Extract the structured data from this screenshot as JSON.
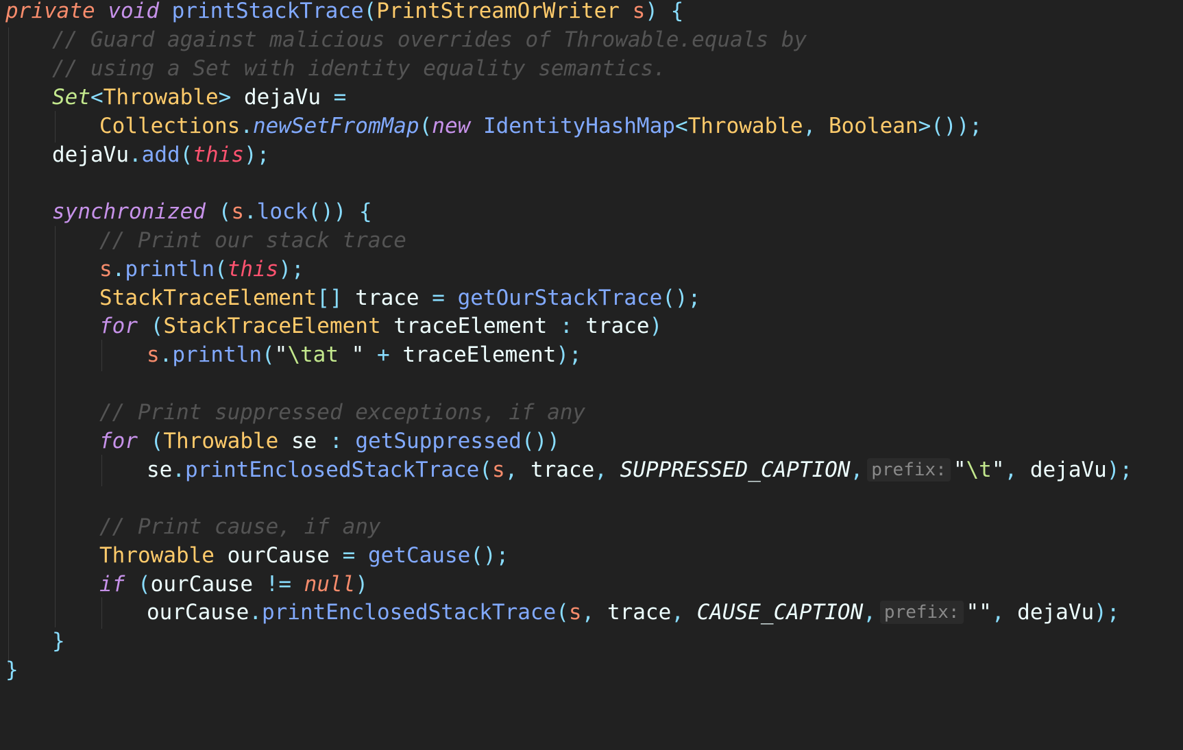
{
  "editor": {
    "background": "#212121",
    "lines": [
      "private void printStackTrace(PrintStreamOrWriter s) {",
      "// Guard against malicious overrides of Throwable.equals by",
      "// using a Set with identity equality semantics.",
      "Set<Throwable> dejaVu =",
      "Collections.newSetFromMap(new IdentityHashMap<Throwable, Boolean>());",
      "dejaVu.add(this);",
      "",
      "synchronized (s.lock()) {",
      "// Print our stack trace",
      "s.println(this);",
      "StackTraceElement[] trace = getOurStackTrace();",
      "for (StackTraceElement traceElement : trace)",
      "s.println(\"\\tat \" + traceElement);",
      "",
      "// Print suppressed exceptions, if any",
      "for (Throwable se : getSuppressed())",
      "se.printEnclosedStackTrace(s, trace, SUPPRESSED_CAPTION, prefix: \"\\t\", dejaVu);",
      "",
      "// Print cause, if any",
      "Throwable ourCause = getCause();",
      "if (ourCause != null)",
      "ourCause.printEnclosedStackTrace(s, trace, CAUSE_CAPTION, prefix: \"\", dejaVu);",
      "}",
      "}"
    ],
    "hints": {
      "prefix_label": "prefix:"
    }
  },
  "colors": {
    "keyword": "#c792ea",
    "return_keyword": "#f78c6c",
    "this_keyword": "#ff5370",
    "type": "#ffcb6b",
    "function": "#82aaff",
    "punctuation": "#89ddff",
    "comment": "#545454",
    "string": "#c3e88d",
    "text": "#eeffff"
  }
}
